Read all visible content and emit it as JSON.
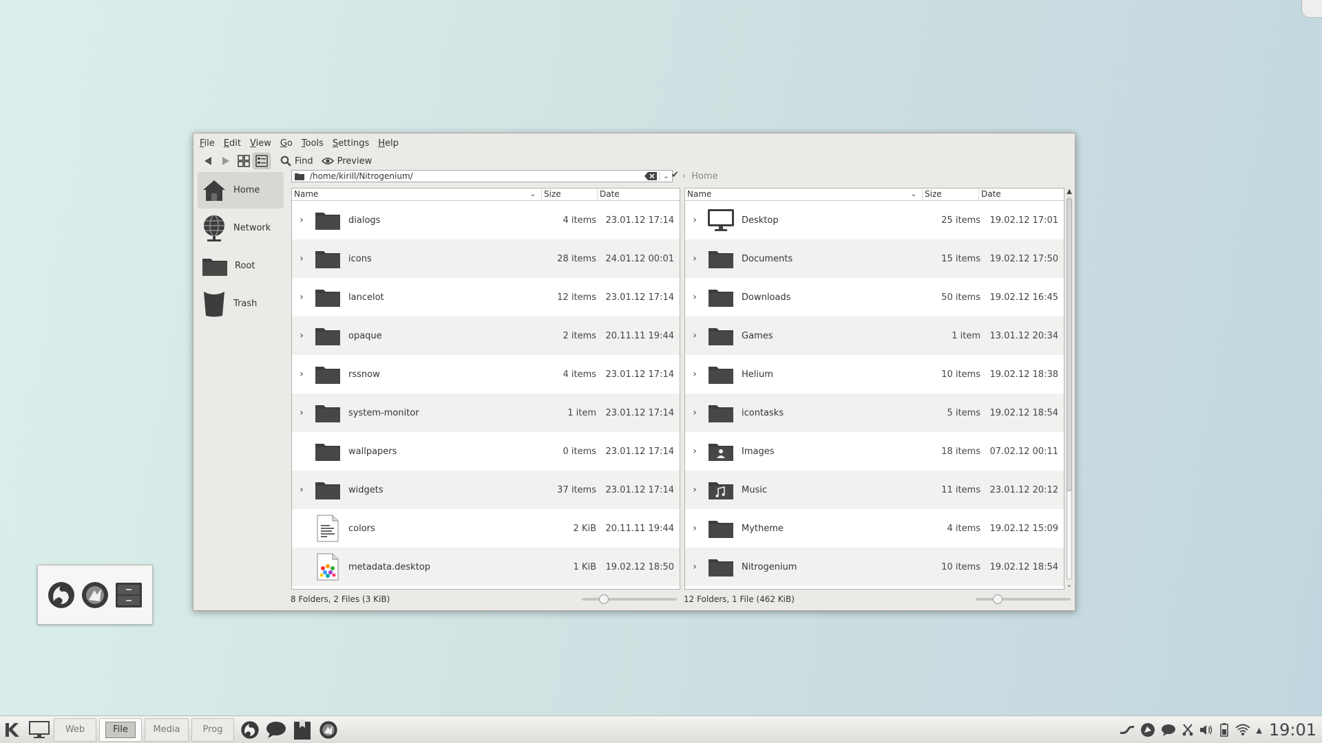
{
  "menu": [
    "File",
    "Edit",
    "View",
    "Go",
    "Tools",
    "Settings",
    "Help"
  ],
  "toolbar": {
    "find": "Find",
    "preview": "Preview"
  },
  "places": [
    {
      "label": "Home",
      "icon": "home-icon",
      "selected": true
    },
    {
      "label": "Network",
      "icon": "network-globe-icon"
    },
    {
      "label": "Root",
      "icon": "folder-icon"
    },
    {
      "label": "Trash",
      "icon": "trash-icon"
    }
  ],
  "left_panel": {
    "path": "/home/kirill/Nitrogenium/",
    "columns": {
      "name": "Name",
      "size": "Size",
      "date": "Date"
    },
    "rows": [
      {
        "name": "dialogs",
        "size": "4 items",
        "date": "23.01.12 17:14",
        "expandable": true,
        "icon": "folder-icon"
      },
      {
        "name": "icons",
        "size": "28 items",
        "date": "24.01.12 00:01",
        "expandable": true,
        "icon": "folder-icon"
      },
      {
        "name": "lancelot",
        "size": "12 items",
        "date": "23.01.12 17:14",
        "expandable": true,
        "icon": "folder-icon"
      },
      {
        "name": "opaque",
        "size": "2 items",
        "date": "20.11.11 19:44",
        "expandable": true,
        "icon": "folder-icon"
      },
      {
        "name": "rssnow",
        "size": "4 items",
        "date": "23.01.12 17:14",
        "expandable": true,
        "icon": "folder-icon"
      },
      {
        "name": "system-monitor",
        "size": "1 item",
        "date": "23.01.12 17:14",
        "expandable": true,
        "icon": "folder-icon"
      },
      {
        "name": "wallpapers",
        "size": "0 items",
        "date": "23.01.12 17:14",
        "expandable": false,
        "icon": "folder-icon"
      },
      {
        "name": "widgets",
        "size": "37 items",
        "date": "23.01.12 17:14",
        "expandable": true,
        "icon": "folder-icon"
      },
      {
        "name": "colors",
        "size": "2 KiB",
        "date": "20.11.11 19:44",
        "expandable": false,
        "icon": "text-file-icon"
      },
      {
        "name": "metadata.desktop",
        "size": "1 KiB",
        "date": "19.02.12 18:50",
        "expandable": false,
        "icon": "desktop-file-icon"
      }
    ],
    "status": "8 Folders, 2 Files (3 KiB)",
    "zoom": 0.2
  },
  "right_panel": {
    "breadcrumb": "Home",
    "columns": {
      "name": "Name",
      "size": "Size",
      "date": "Date"
    },
    "rows": [
      {
        "name": "Desktop",
        "size": "25 items",
        "date": "19.02.12 17:01",
        "expandable": true,
        "icon": "monitor-icon"
      },
      {
        "name": "Documents",
        "size": "15 items",
        "date": "19.02.12 17:50",
        "expandable": true,
        "icon": "folder-icon"
      },
      {
        "name": "Downloads",
        "size": "50 items",
        "date": "19.02.12 16:45",
        "expandable": true,
        "icon": "folder-icon"
      },
      {
        "name": "Games",
        "size": "1 item",
        "date": "13.01.12 20:34",
        "expandable": true,
        "icon": "folder-icon"
      },
      {
        "name": "Helium",
        "size": "10 items",
        "date": "19.02.12 18:38",
        "expandable": true,
        "icon": "folder-icon"
      },
      {
        "name": "icontasks",
        "size": "5 items",
        "date": "19.02.12 18:54",
        "expandable": true,
        "icon": "folder-icon"
      },
      {
        "name": "Images",
        "size": "18 items",
        "date": "07.02.12 00:11",
        "expandable": true,
        "icon": "image-folder-icon"
      },
      {
        "name": "Music",
        "size": "11 items",
        "date": "23.01.12 20:12",
        "expandable": true,
        "icon": "music-folder-icon"
      },
      {
        "name": "Mytheme",
        "size": "4 items",
        "date": "19.02.12 15:09",
        "expandable": true,
        "icon": "folder-icon"
      },
      {
        "name": "Nitrogenium",
        "size": "10 items",
        "date": "19.02.12 18:54",
        "expandable": true,
        "icon": "folder-icon"
      }
    ],
    "status": "12 Folders, 1 File (462 KiB)",
    "zoom": 0.2
  },
  "taskbar": {
    "workspaces": [
      {
        "label": "Web"
      },
      {
        "label": "File",
        "active": true
      },
      {
        "label": "Media"
      },
      {
        "label": "Prog"
      }
    ],
    "clock": "19:01"
  },
  "colors": {
    "folder": "#3f3f3f",
    "selection": "#d9d7d3",
    "row_alt": "#f2f1ef"
  }
}
